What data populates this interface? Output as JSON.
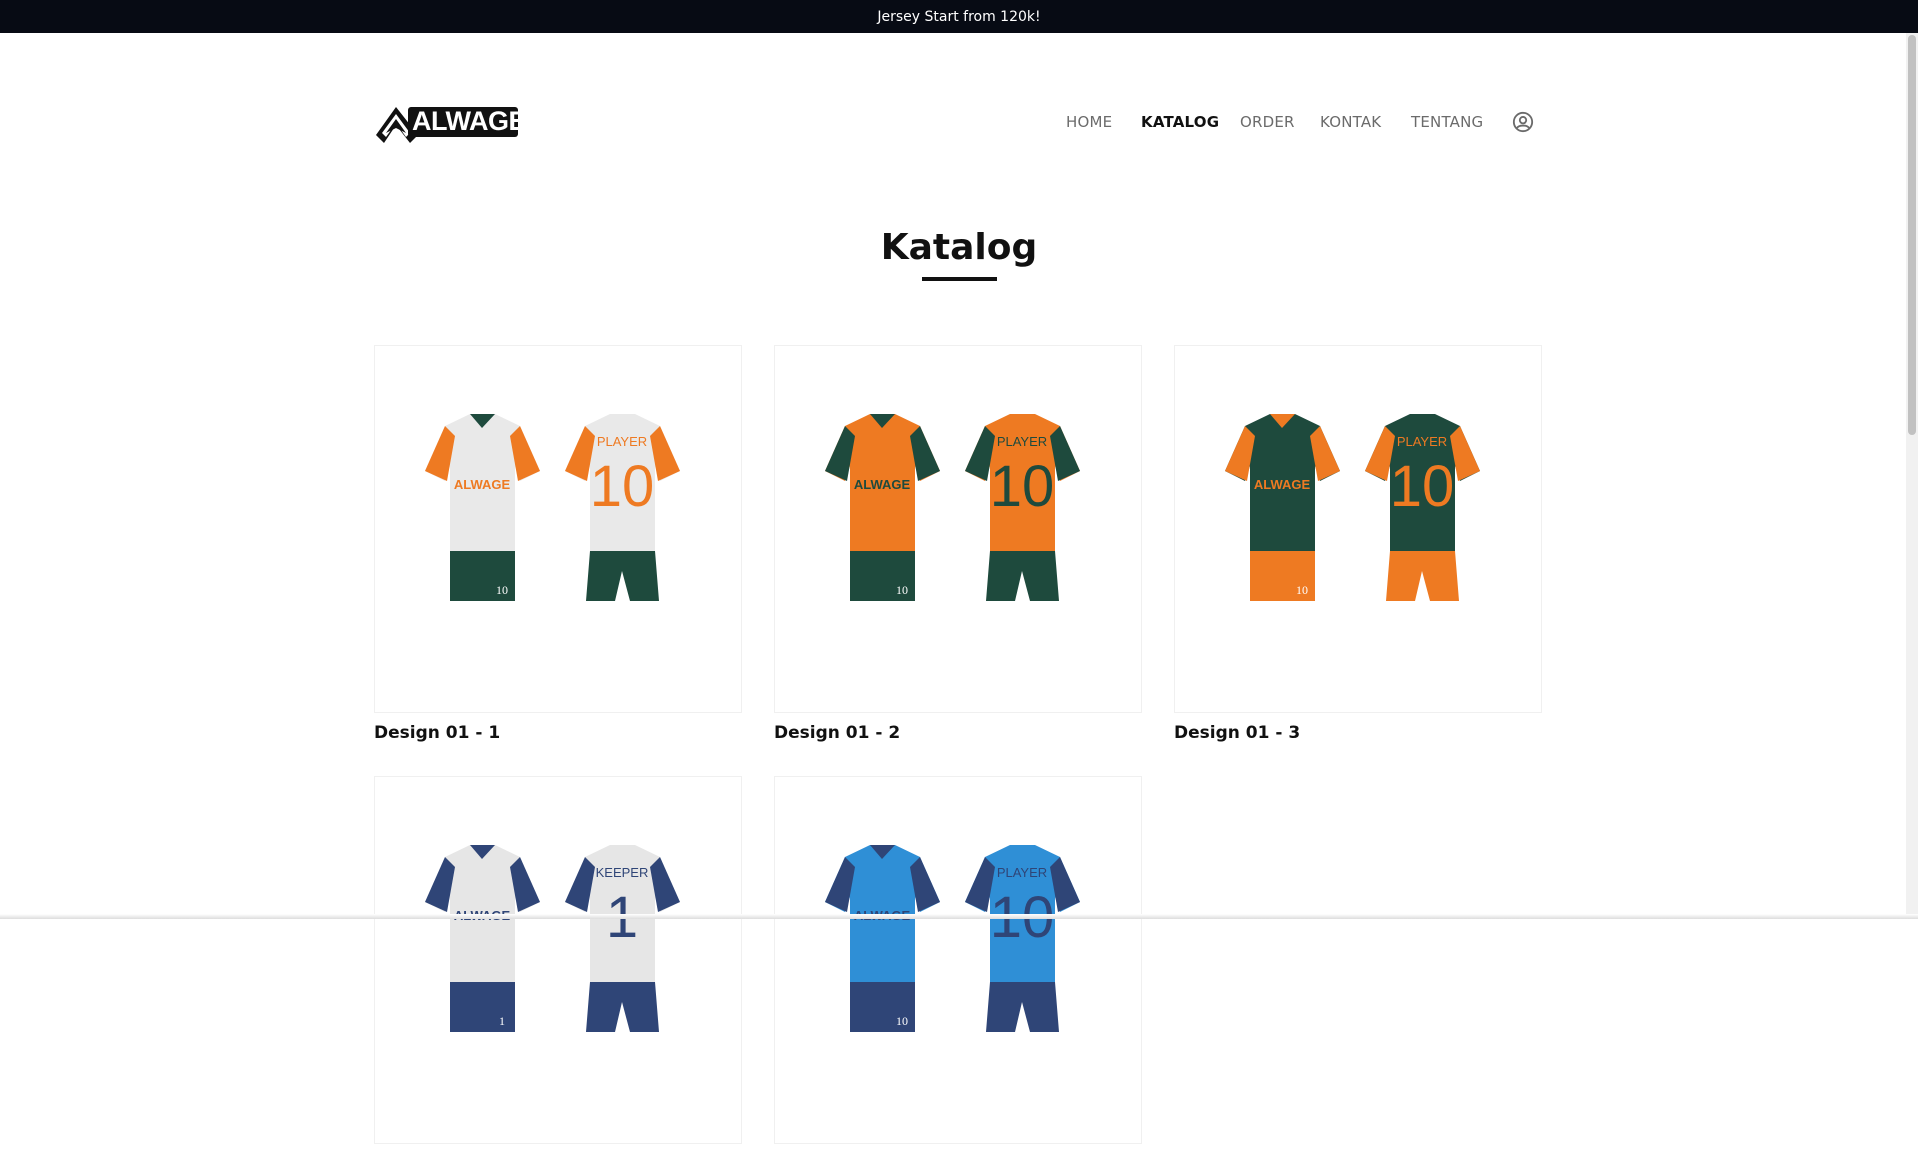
{
  "announcement": "Jersey Start from 120k!",
  "brand": {
    "logo_text": "ALWAGE"
  },
  "nav": {
    "items": [
      {
        "label": "HOME",
        "active": false
      },
      {
        "label": "KATALOG",
        "active": true
      },
      {
        "label": "ORDER",
        "active": false
      },
      {
        "label": "KONTAK",
        "active": false
      },
      {
        "label": "TENTANG",
        "active": false
      }
    ],
    "user_icon": "user-circle-icon"
  },
  "page": {
    "title": "Katalog"
  },
  "products": [
    {
      "name": "Design 01 - 1",
      "colors": {
        "body": "#e9e9e9",
        "accent": "#ee7a22",
        "trim": "#1e4a3d",
        "shorts": "#1e4a3d"
      },
      "front_text": "ALWAGE",
      "back_text": "PLAYER",
      "number": "10"
    },
    {
      "name": "Design 01 - 2",
      "colors": {
        "body": "#ee7a22",
        "accent": "#1e4a3d",
        "trim": "#1e4a3d",
        "shorts": "#1e4a3d"
      },
      "front_text": "ALWAGE",
      "back_text": "PLAYER",
      "number": "10"
    },
    {
      "name": "Design 01 - 3",
      "colors": {
        "body": "#1e4a3d",
        "accent": "#ee7a22",
        "trim": "#ee7a22",
        "shorts": "#ee7a22"
      },
      "front_text": "ALWAGE",
      "back_text": "PLAYER",
      "number": "10"
    },
    {
      "name": "",
      "colors": {
        "body": "#e6e6e6",
        "accent": "#2f4577",
        "trim": "#2f4577",
        "shorts": "#2f4577"
      },
      "front_text": "ALWAGE",
      "back_text": "KEEPER",
      "number": "1"
    },
    {
      "name": "",
      "colors": {
        "body": "#2f8fd6",
        "accent": "#2f4577",
        "trim": "#2f4577",
        "shorts": "#2f4577"
      },
      "front_text": "ALWAGE",
      "back_text": "PLAYER",
      "number": "10"
    }
  ]
}
